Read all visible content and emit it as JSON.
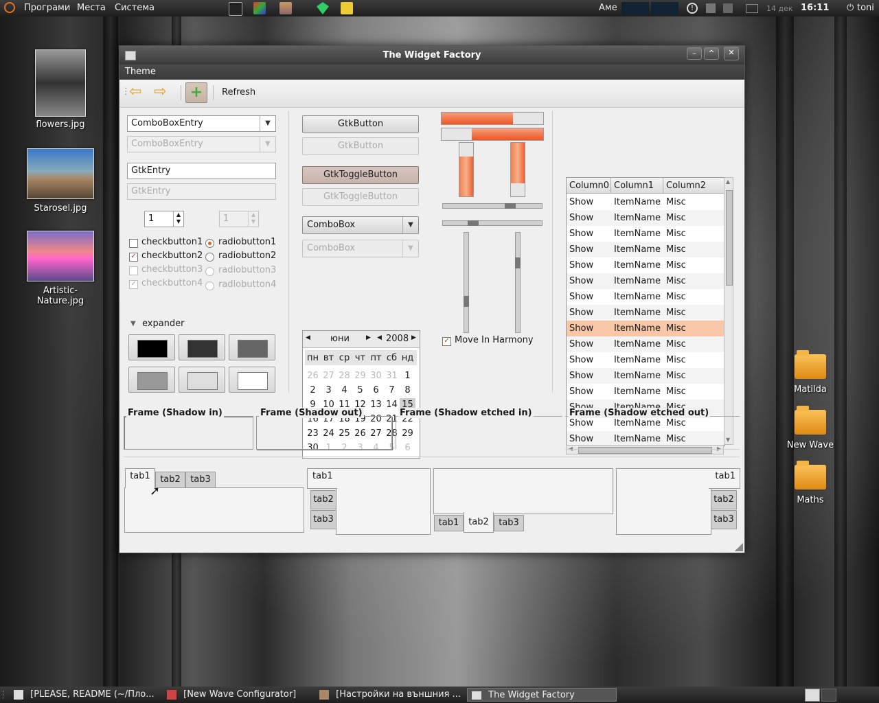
{
  "top_panel": {
    "menus": [
      "Програми",
      "Места",
      "Система"
    ],
    "keyboard_layout": "Аме",
    "date": "14 дек",
    "time": "16:11",
    "user": "toni"
  },
  "desktop": {
    "left_icons": [
      "flowers.jpg",
      "Starosel.jpg",
      "Artistic-Nature.jpg"
    ],
    "right_icons": [
      "Matilda",
      "New Wave",
      "Maths"
    ]
  },
  "window": {
    "title": "The Widget Factory",
    "menu": [
      "Theme"
    ],
    "toolbar": {
      "refresh_label": "Refresh"
    },
    "combo_entry": "ComboBoxEntry",
    "combo_entry_disabled": "ComboBoxEntry",
    "entry": "GtkEntry",
    "entry_disabled": "GtkEntry",
    "spin_value": "1",
    "spin_value_disabled": "1",
    "checks": [
      "checkbutton1",
      "checkbutton2",
      "checkbutton3",
      "checkbutton4"
    ],
    "radios": [
      "radiobutton1",
      "radiobutton2",
      "radiobutton3",
      "radiobutton4"
    ],
    "expander": "expander",
    "swatch_colors": [
      "#000000",
      "#333333",
      "#666666",
      "#999999",
      "#dddddd",
      "#ffffff"
    ],
    "buttons": {
      "gtk_button": "GtkButton",
      "gtk_button_disabled": "GtkButton",
      "toggle": "GtkToggleButton",
      "toggle_disabled": "GtkToggleButton",
      "combo": "ComboBox",
      "combo_disabled": "ComboBox"
    },
    "calendar": {
      "month": "юни",
      "year": "2008",
      "weekdays": [
        "пн",
        "вт",
        "ср",
        "чт",
        "пт",
        "сб",
        "нд"
      ],
      "days": [
        [
          "26",
          "27",
          "28",
          "29",
          "30",
          "31",
          "1"
        ],
        [
          "2",
          "3",
          "4",
          "5",
          "6",
          "7",
          "8"
        ],
        [
          "9",
          "10",
          "11",
          "12",
          "13",
          "14",
          "15"
        ],
        [
          "16",
          "17",
          "18",
          "19",
          "20",
          "21",
          "22"
        ],
        [
          "23",
          "24",
          "25",
          "26",
          "27",
          "28",
          "29"
        ],
        [
          "30",
          "1",
          "2",
          "3",
          "4",
          "5",
          "6"
        ]
      ],
      "selected_day": "15"
    },
    "progress": {
      "h1": 0.7,
      "h2": 0.7,
      "v1": 0.75,
      "v2": 0.75
    },
    "move_in_harmony": "Move In Harmony",
    "tree": {
      "columns": [
        "Column0",
        "Column1",
        "Column2"
      ],
      "rows": [
        [
          "Show",
          "ItemName",
          "Misc"
        ],
        [
          "Show",
          "ItemName",
          "Misc"
        ],
        [
          "Show",
          "ItemName",
          "Misc"
        ],
        [
          "Show",
          "ItemName",
          "Misc"
        ],
        [
          "Show",
          "ItemName",
          "Misc"
        ],
        [
          "Show",
          "ItemName",
          "Misc"
        ],
        [
          "Show",
          "ItemName",
          "Misc"
        ],
        [
          "Show",
          "ItemName",
          "Misc"
        ],
        [
          "Show",
          "ItemName",
          "Misc"
        ],
        [
          "Show",
          "ItemName",
          "Misc"
        ],
        [
          "Show",
          "ItemName",
          "Misc"
        ],
        [
          "Show",
          "ItemName",
          "Misc"
        ],
        [
          "Show",
          "ItemName",
          "Misc"
        ],
        [
          "Show",
          "ItemName",
          "Misc"
        ],
        [
          "Show",
          "ItemName",
          "Misc"
        ],
        [
          "Show",
          "ItemName",
          "Misc"
        ]
      ],
      "selected_row": 8
    },
    "frames": [
      "Frame (Shadow in)",
      "Frame (Shadow out)",
      "Frame (Shadow etched in)",
      "Frame (Shadow etched out)"
    ],
    "tabs": [
      "tab1",
      "tab2",
      "tab3"
    ]
  },
  "taskbar": [
    "[PLEASE, README (~/Пло...",
    "[New Wave Configurator]",
    "[Настройки на външния ...",
    "The Widget Factory"
  ]
}
